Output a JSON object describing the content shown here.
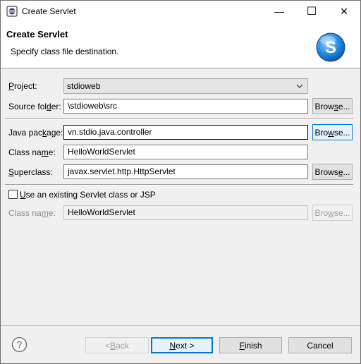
{
  "window": {
    "title": "Create Servlet",
    "minimize_glyph": "—",
    "maximize_glyph": "☐",
    "close_glyph": "✕"
  },
  "banner": {
    "title": "Create Servlet",
    "description": "Specify class file destination.",
    "logo_letter": "S"
  },
  "form": {
    "project": {
      "label_pre": "",
      "label_u": "P",
      "label_post": "roject:",
      "value": "stdioweb",
      "arrow": "⌄"
    },
    "source_folder": {
      "label_pre": "Source fol",
      "label_u": "d",
      "label_post": "er:",
      "value": "\\stdioweb\\src",
      "browse_pre": "Brow",
      "browse_u": "s",
      "browse_post": "e..."
    },
    "java_package": {
      "label_pre": "Java pac",
      "label_u": "k",
      "label_post": "age:",
      "value": "vn.stdio.java.controller",
      "browse_pre": "Bro",
      "browse_u": "w",
      "browse_post": "se..."
    },
    "class_name": {
      "label_pre": "Class na",
      "label_u": "m",
      "label_post": "e:",
      "value": "HelloWorldServlet"
    },
    "superclass": {
      "label_pre": "",
      "label_u": "S",
      "label_post": "uperclass:",
      "value": "javax.servlet.http.HttpServlet",
      "browse_pre": "Brows",
      "browse_u": "e",
      "browse_post": "..."
    },
    "existing": {
      "label_pre": "",
      "label_u": "U",
      "label_post": "se an existing Servlet class or JSP",
      "checked": false
    },
    "existing_class_name": {
      "label_pre": "Class na",
      "label_u": "m",
      "label_post": "e:",
      "value": "HelloWorldServlet",
      "browse_pre": "Bro",
      "browse_u": "w",
      "browse_post": "se..."
    }
  },
  "footer": {
    "help_glyph": "?",
    "back_pre": "< ",
    "back_u": "B",
    "back_post": "ack",
    "next_pre": "",
    "next_u": "N",
    "next_post": "ext >",
    "finish_pre": "",
    "finish_u": "F",
    "finish_post": "inish",
    "cancel": "Cancel"
  },
  "colors": {
    "accent": "#0078d7",
    "logo_blue": "#1e88e5"
  }
}
